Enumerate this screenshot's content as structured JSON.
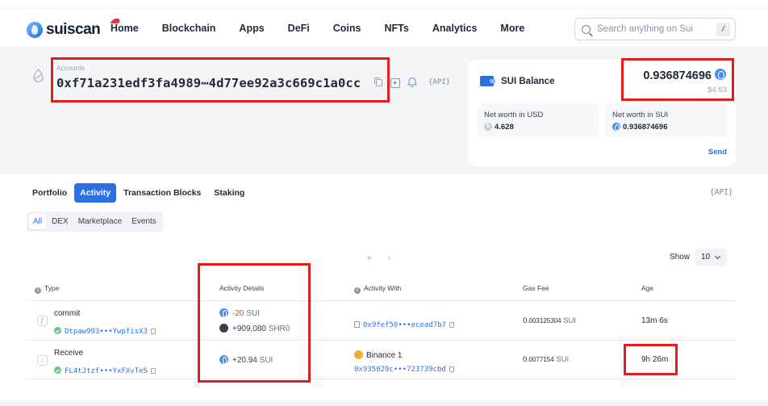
{
  "brand": {
    "logo_text": "suiscan"
  },
  "nav": {
    "items": [
      "Home",
      "Blockchain",
      "Apps",
      "DeFi",
      "Coins",
      "NFTs",
      "Analytics",
      "More"
    ],
    "search_placeholder": "Search anything on Sui",
    "search_shortcut": "/"
  },
  "account": {
    "label": "Accounts",
    "address": "0xf71a231edf3fa4989⋯4d77ee92a3c669c1a0cc",
    "api_label": "{API}"
  },
  "balance": {
    "title": "SUI Balance",
    "value": "0.936874696",
    "usd": "$4.63",
    "net_worth_usd_label": "Net worth in USD",
    "net_worth_usd_value": "4.628",
    "net_worth_sui_label": "Net worth in SUI",
    "net_worth_sui_value": "0.936874696",
    "send_label": "Send"
  },
  "tabs": {
    "items": [
      "Portfolio",
      "Activity",
      "Transaction Blocks",
      "Staking"
    ],
    "active": "Activity",
    "api_label": "{API}"
  },
  "subtabs": {
    "items": [
      "All",
      "DEX",
      "Marketplace",
      "Events"
    ],
    "active": "All"
  },
  "pagination": {
    "first": "«",
    "prev": "‹",
    "show_label": "Show",
    "page_size": "10"
  },
  "table": {
    "headers": {
      "type": "Type",
      "details": "Activity Details",
      "with": "Activity With",
      "gas": "Gas Fee",
      "age": "Age"
    },
    "rows": [
      {
        "type": "commit",
        "digest": "Dtpaw993•••YwpfisX3",
        "details": [
          {
            "amount": "-20",
            "unit": "SUI"
          },
          {
            "amount": "+909,080",
            "unit": "SHR0"
          }
        ],
        "with_name": "",
        "with_address": "0x9fef50•••ecead7b7",
        "gas_lead": "0",
        "gas_rest": ".003125304",
        "gas_unit": "SUI",
        "age": "13m 6s"
      },
      {
        "type": "Receive",
        "digest": "FL4tJtzf•••YxFXvTeS",
        "details": [
          {
            "amount": "+20.94",
            "unit": "SUI"
          }
        ],
        "with_name": "Binance 1",
        "with_address": "0x935029c•••723739cbd",
        "gas_lead": "0",
        "gas_rest": ".0077154",
        "gas_unit": "SUI",
        "age": "9h 26m"
      }
    ]
  },
  "colors": {
    "accent": "#2f6fe4",
    "highlight": "#e11d1d",
    "negative": "#c25a1b"
  }
}
